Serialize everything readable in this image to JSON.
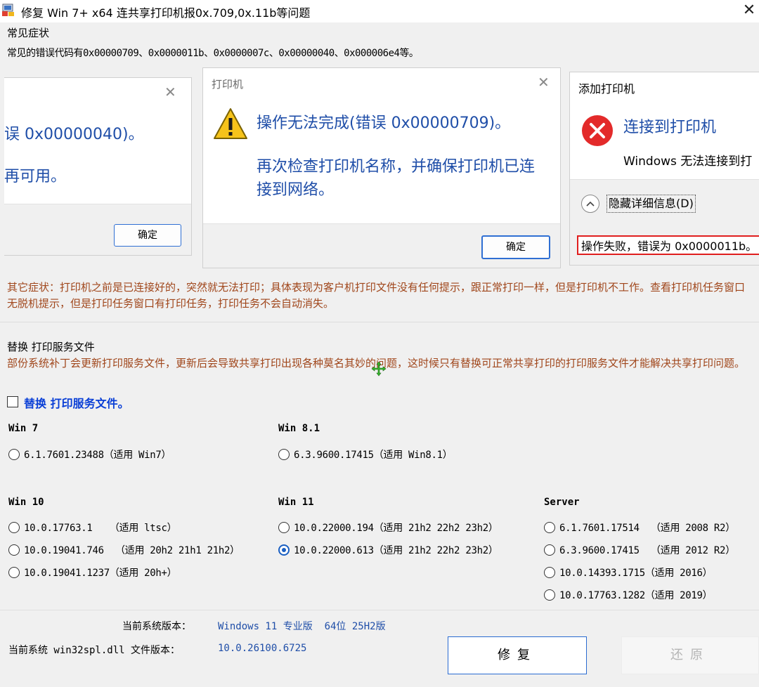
{
  "window": {
    "title": "修复 Win 7+ x64 连共享打印机报0x.709,0x.11b等问题",
    "close": "✕"
  },
  "symptoms": {
    "title": "常见症状",
    "codes": "常见的错误代码有0x00000709、0x0000011b、0x0000007c、0x00000040、0x000006e4等。"
  },
  "dialog_left": {
    "line1": "误 0x00000040)。",
    "line2": "再可用。",
    "ok": "确定"
  },
  "dialog_mid": {
    "title": "打印机",
    "line1": "操作无法完成(错误 0x00000709)。",
    "line2a": "再次检查打印机名称，并确保打印机已连",
    "line2b": "接到网络。",
    "ok": "确定"
  },
  "dialog_right": {
    "title": "添加打印机",
    "heading": "连接到打印机",
    "body": "Windows 无法连接到打",
    "hide_details": "隐藏详细信息(D)",
    "error": "操作失败，错误为 0x0000011b。"
  },
  "other_symptoms": "其它症状：打印机之前是已连接好的，突然就无法打印；具体表现为客户机打印文件没有任何提示，跟正常打印一样，但是打印机不工作。查看打印机任务窗口无脱机提示，但是打印任务窗口有打印任务，打印任务不会自动消失。",
  "replace": {
    "title": "替换 打印服务文件",
    "desc": "部份系统补丁会更新打印服务文件，更新后会导致共享打印出现各种莫名其妙的问题，这时候只有替换可正常共享打印的打印服务文件才能解决共享打印问题。",
    "checkbox_label": "替换 打印服务文件。"
  },
  "groups": {
    "win7": {
      "label": "Win 7",
      "options": [
        "6.1.7601.23488（适用 Win7）"
      ]
    },
    "win81": {
      "label": "Win 8.1",
      "options": [
        "6.3.9600.17415（适用 Win8.1）"
      ]
    },
    "win10": {
      "label": "Win 10",
      "options": [
        "10.0.17763.1   （适用 ltsc）",
        "10.0.19041.746  （适用 20h2 21h1 21h2）",
        "10.0.19041.1237（适用 20h+）"
      ]
    },
    "win11": {
      "label": "Win 11",
      "options": [
        "10.0.22000.194（适用 21h2 22h2 23h2）",
        "10.0.22000.613（适用 21h2 22h2 23h2）"
      ],
      "selected": 1
    },
    "server": {
      "label": "Server",
      "options": [
        "6.1.7601.17514  （适用 2008 R2）",
        "6.3.9600.17415  （适用 2012 R2）",
        "10.0.14393.1715（适用 2016）",
        "10.0.17763.1282（适用 2019）"
      ]
    }
  },
  "status": {
    "os_label": "当前系统版本：",
    "os_value": "Windows 11 专业版  64位 25H2版",
    "dll_label": "当前系统 win32spl.dll 文件版本：",
    "dll_value": "10.0.26100.6725"
  },
  "buttons": {
    "fix": "修复",
    "restore": "还原"
  },
  "colors": {
    "link_blue": "#1f4ea8",
    "warn_text": "#a0461b",
    "accent": "#2a6bd1",
    "error_red": "#e32a2a"
  }
}
